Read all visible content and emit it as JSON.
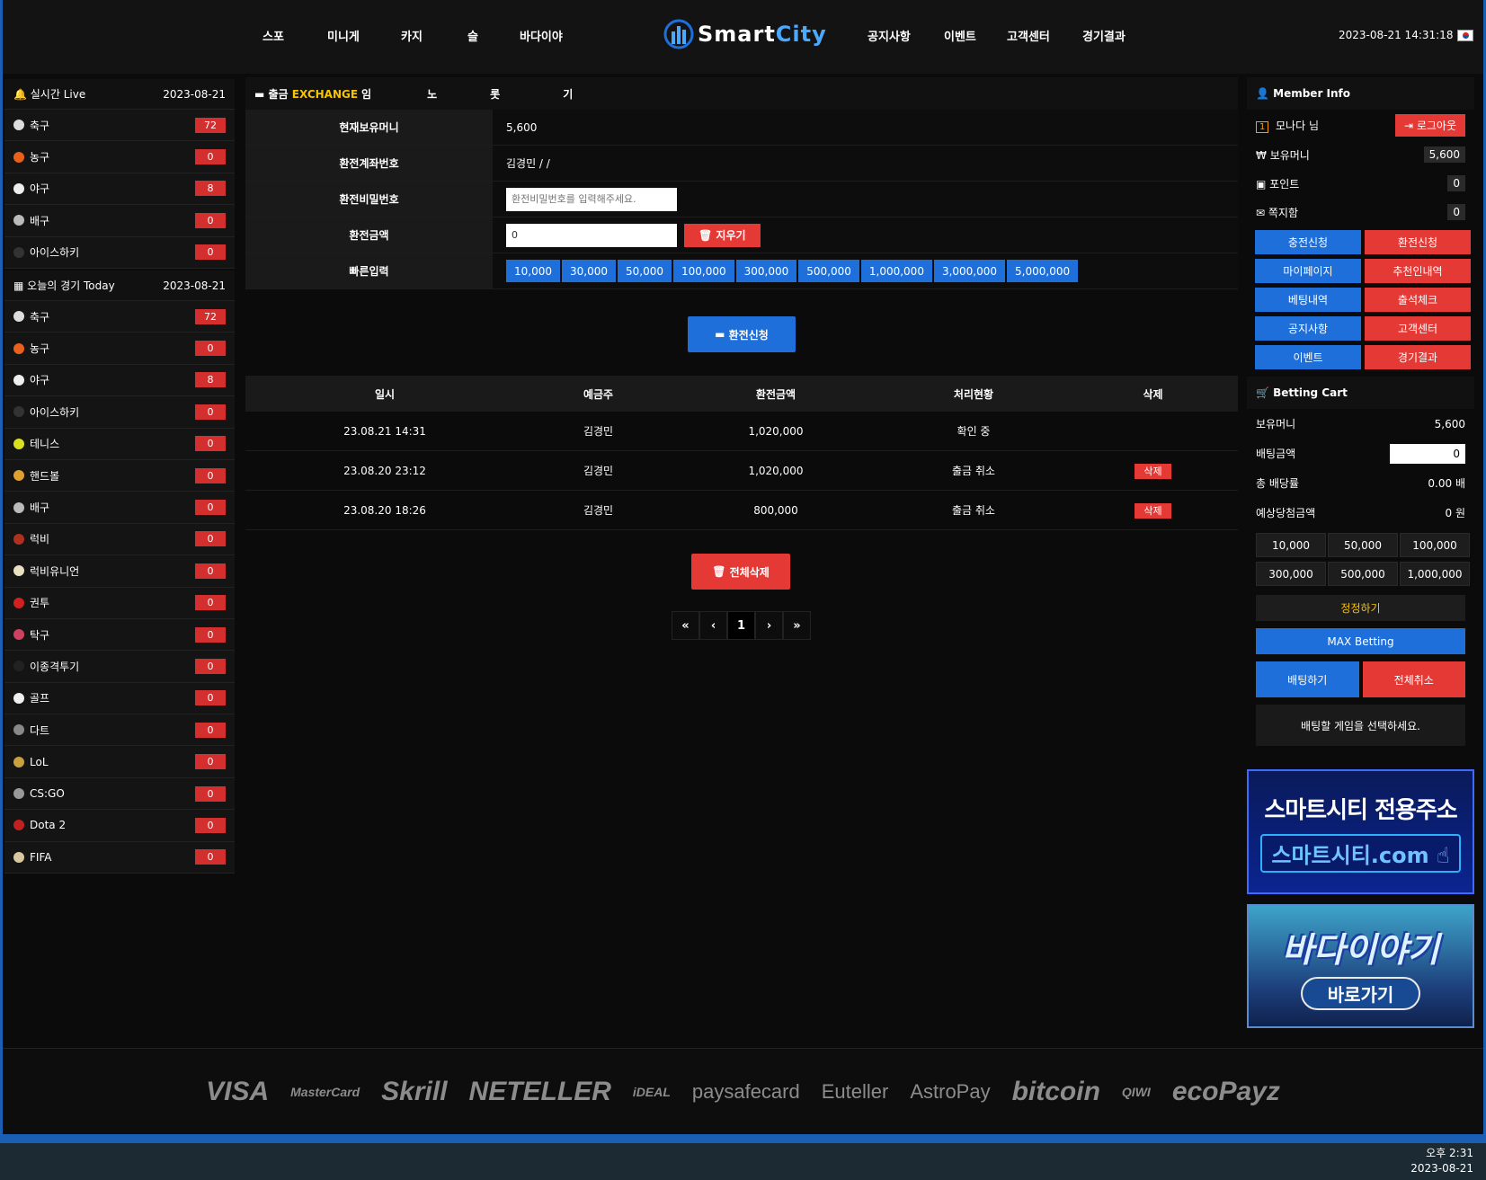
{
  "header": {
    "nav_left": [
      "스포",
      "미니게",
      "카지",
      "슬",
      "바다이야"
    ],
    "nav_right": [
      "공지사항",
      "이벤트",
      "고객센터",
      "경기결과"
    ],
    "logo_a": "Smart",
    "logo_b": "City",
    "datetime": "2023-08-21 14:31:18"
  },
  "live": {
    "title": "실시간 Live",
    "date": "2023-08-21",
    "items": [
      {
        "label": "축구",
        "count": "72",
        "color": "#dddddd"
      },
      {
        "label": "농구",
        "count": "0",
        "color": "#e8601a"
      },
      {
        "label": "야구",
        "count": "8",
        "color": "#eeeeee"
      },
      {
        "label": "배구",
        "count": "0",
        "color": "#bbbbbb"
      },
      {
        "label": "아이스하키",
        "count": "0",
        "color": "#333333"
      }
    ]
  },
  "today": {
    "title": "오늘의 경기 Today",
    "date": "2023-08-21",
    "items": [
      {
        "label": "축구",
        "count": "72",
        "color": "#dddddd"
      },
      {
        "label": "농구",
        "count": "0",
        "color": "#e8601a"
      },
      {
        "label": "야구",
        "count": "8",
        "color": "#eeeeee"
      },
      {
        "label": "아이스하키",
        "count": "0",
        "color": "#333333"
      },
      {
        "label": "테니스",
        "count": "0",
        "color": "#d8e020"
      },
      {
        "label": "핸드볼",
        "count": "0",
        "color": "#e0a030"
      },
      {
        "label": "배구",
        "count": "0",
        "color": "#bbbbbb"
      },
      {
        "label": "럭비",
        "count": "0",
        "color": "#b03020"
      },
      {
        "label": "럭비유니언",
        "count": "0",
        "color": "#e8e0c0"
      },
      {
        "label": "권투",
        "count": "0",
        "color": "#d02020"
      },
      {
        "label": "탁구",
        "count": "0",
        "color": "#d04060"
      },
      {
        "label": "이종격투기",
        "count": "0",
        "color": "#222222"
      },
      {
        "label": "골프",
        "count": "0",
        "color": "#f0f0f0"
      },
      {
        "label": "다트",
        "count": "0",
        "color": "#888888"
      },
      {
        "label": "LoL",
        "count": "0",
        "color": "#c8a040"
      },
      {
        "label": "CS:GO",
        "count": "0",
        "color": "#999999"
      },
      {
        "label": "Dota 2",
        "count": "0",
        "color": "#c02020"
      },
      {
        "label": "FIFA",
        "count": "0",
        "color": "#d8c8a0"
      }
    ]
  },
  "exchange": {
    "tab_prefix": "출금",
    "tab_ex": "EXCHANGE",
    "tab_rest": [
      "임",
      "노",
      "롯",
      "기"
    ],
    "rows": {
      "money_label": "현재보유머니",
      "money_value": "5,600",
      "account_label": "환전계좌번호",
      "account_value": "김경민 / /",
      "pw_label": "환전비밀번호",
      "pw_placeholder": "환전비밀번호를 입력해주세요.",
      "amount_label": "환전금액",
      "amount_value": "0",
      "clear_label": "지우기",
      "quick_label": "빠른입력"
    },
    "quick": [
      "10,000",
      "30,000",
      "50,000",
      "100,000",
      "300,000",
      "500,000",
      "1,000,000",
      "3,000,000",
      "5,000,000"
    ],
    "submit_label": "환전신청"
  },
  "history": {
    "headers": [
      "일시",
      "예금주",
      "환전금액",
      "처리현황",
      "삭제"
    ],
    "rows": [
      {
        "date": "23.08.21 14:31",
        "holder": "김경민",
        "amount": "1,020,000",
        "status": "확인 중",
        "del": ""
      },
      {
        "date": "23.08.20 23:12",
        "holder": "김경민",
        "amount": "1,020,000",
        "status": "출금 취소",
        "del": "삭제"
      },
      {
        "date": "23.08.20 18:26",
        "holder": "김경민",
        "amount": "800,000",
        "status": "출금 취소",
        "del": "삭제"
      }
    ],
    "delete_all": "전체삭제",
    "pager": [
      "«",
      "‹",
      "1",
      "›",
      "»"
    ]
  },
  "member": {
    "title": "Member Info",
    "level": "1",
    "name": "모나다 님",
    "logout": "로그아웃",
    "money_label": "보유머니",
    "money": "5,600",
    "point_label": "포인트",
    "point": "0",
    "msg_label": "쪽지함",
    "msg": "0",
    "buttons": [
      {
        "label": "충전신청",
        "color": "b"
      },
      {
        "label": "환전신청",
        "color": "r"
      },
      {
        "label": "마이페이지",
        "color": "b"
      },
      {
        "label": "추천인내역",
        "color": "r"
      },
      {
        "label": "베팅내역",
        "color": "b"
      },
      {
        "label": "출석체크",
        "color": "r"
      },
      {
        "label": "공지사항",
        "color": "b"
      },
      {
        "label": "고객센터",
        "color": "r"
      },
      {
        "label": "이벤트",
        "color": "b"
      },
      {
        "label": "경기결과",
        "color": "r"
      }
    ]
  },
  "cart": {
    "title": "Betting Cart",
    "money_label": "보유머니",
    "money": "5,600",
    "bet_label": "배팅금액",
    "bet": "0",
    "odds_label": "총 배당률",
    "odds": "0.00 배",
    "win_label": "예상당첨금액",
    "win": "0 원",
    "amounts": [
      "10,000",
      "50,000",
      "100,000",
      "300,000",
      "500,000",
      "1,000,000"
    ],
    "fix": "정정하기",
    "max": "MAX Betting",
    "bet_btn": "배팅하기",
    "cancel_btn": "전체취소",
    "notice": "배팅할 게임을 선택하세요."
  },
  "banners": {
    "b1_title": "스마트시티 전용주소",
    "b1_url": "스마트시티.com",
    "b2_title": "바다이야기",
    "b2_btn": "바로가기"
  },
  "footer": {
    "payments": [
      "VISA",
      "MasterCard",
      "Skrill",
      "NETELLER",
      "iDEAL",
      "paysafecard",
      "Euteller",
      "AstroPay",
      "bitcoin",
      "QIWI",
      "ecoPayz"
    ]
  },
  "taskbar": {
    "time": "오후 2:31",
    "date": "2023-08-21"
  },
  "colors": {
    "blue": "#1e6fd9",
    "red": "#e53935",
    "yellow": "#f5c400"
  }
}
